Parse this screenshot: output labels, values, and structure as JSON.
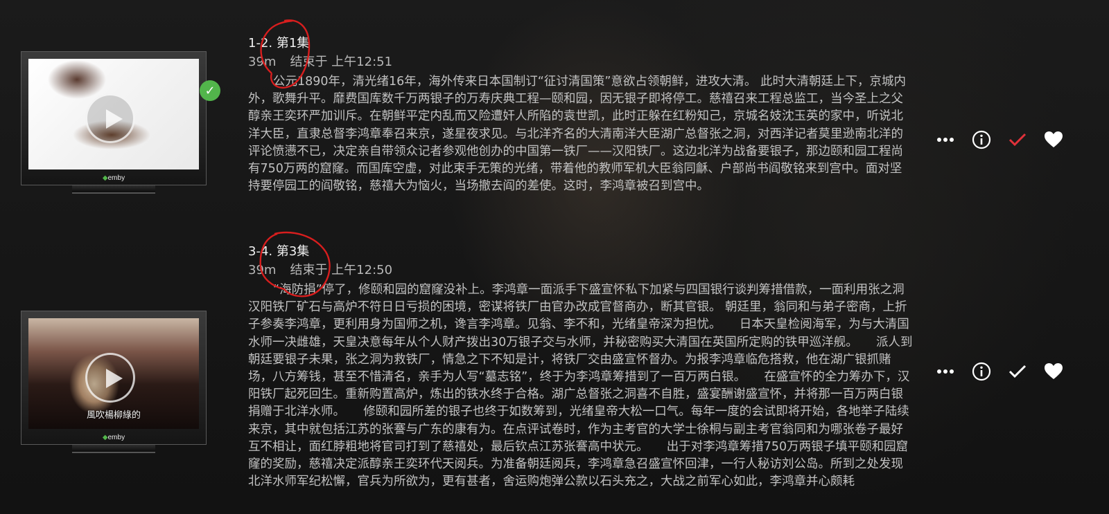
{
  "episodes": [
    {
      "title": "1-2. 第1集",
      "duration": "39m",
      "ends_at": "结束于 上午12:51",
      "overview": "公元1890年，清光绪16年，海外传来日本国制订“征讨清国策”意欲占领朝鲜，进攻大清。 此时大清朝廷上下，京城内外，歌舞升平。靡费国库数千万两银子的万寿庆典工程—颐和园，因无银子即将停工。慈禧召来工程总监工，当今圣上之父醇亲王奕环严加训斥。在朝鲜平定内乱而又险遭奸人所陷的袁世凯，此时正躲在红粉知己，京城名妓沈玉英的家中，听说北洋大臣，直隶总督李鸿章奉召来京，遂星夜求见。与北洋齐名的大清南洋大臣湖广总督张之洞，对西洋记者莫里逊南北洋的评论愤懑不已，决定亲自带领众记者参观他创办的中国第一铁厂——汉阳铁厂。这边北洋为战备要银子，那边颐和园工程尚有750万两的窟窿。而国库空虚，对此束手无策的光绪，带着他的教师军机大臣翁同龢、户部尚书阎敬铭来到宫中。面对坚持要停园工的阎敬铭，慈禧大为恼火，当场撤去阎的差使。这时，李鸿章被召到宫中。",
      "thumbnail_label": "emby",
      "caption": "",
      "watched": true,
      "watched_color": "#e0313a"
    },
    {
      "title": "3-4. 第3集",
      "duration": "39m",
      "ends_at": "结束于 上午12:50",
      "overview": "“海防捐”停了，修颐和园的窟窿没补上。李鸿章一面派手下盛宣怀私下加紧与四国银行谈判筹措借款，一面利用张之洞汉阳铁厂矿石与高炉不符日日亏损的困境，密谋将铁厂由官办改成官督商办，断其官银。 朝廷里，翁同和与弟子密商，上折子参奏李鸿章，更利用身为国师之机，谗言李鸿章。见翁、李不和，光绪皇帝深为担忧。　　日本天皇检阅海军，为与大清国水师一决雌雄，天皇决意每年从个人财产拨出30万银子交与水师，并秘密购买大清国在英国所定购的铁甲巡洋舰。　　派人到朝廷要银子未果，张之洞为救铁厂，情急之下不知是计，将铁厂交由盛宣怀督办。为报李鸿章临危搭救，他在湖广银抓赌场，八方筹钱，甚至不惜清名，亲手为人写“墓志铭”，终于为李鸿章筹措到了一百万两白银。　　在盛宣怀的全力筹办下，汉阳铁厂起死回生。重新购置高炉，炼出的铁水终于合格。湖广总督张之洞喜不自胜，盛宴酬谢盛宣怀，并将那一百万两白银捐赠于北洋水师。　　修颐和园所差的银子也终于如数筹到，光绪皇帝大松一口气。每年一度的会试即将开始，各地举子陆续来京，其中就包括江苏的张謇与广东的康有为。在点评试卷时，作为主考官的大学士徐桐与副主考官翁同和为哪张卷子最好互不相让，面红脖粗地将官司打到了慈禧处，最后钦点江苏张謇高中状元。　　出于对李鸿章筹措750万两银子填平颐和园窟窿的奖励，慈禧决定派醇亲王奕环代天阅兵。为准备朝廷阅兵，李鸿章急召盛宣怀回津，一行人秘访刘公岛。所到之处发现北洋水师军纪松懈，官兵为所欲为，更有甚者，舍运购炮弹公款以石头充之，大战之前军心如此，李鸿章并心颇耗",
      "thumbnail_label": "emby",
      "caption": "風吹楊柳綠的",
      "watched": false,
      "watched_color": "#ffffff"
    }
  ],
  "icons": {
    "more": "more-horizontal-icon",
    "info": "info-circle-icon",
    "played": "checkmark-icon",
    "favorite": "heart-icon",
    "play": "play-icon",
    "watched_badge": "check-badge-icon"
  },
  "colors": {
    "accent_green": "#52b54b",
    "played_red": "#e0313a",
    "annotation_red": "#d81e1e"
  }
}
